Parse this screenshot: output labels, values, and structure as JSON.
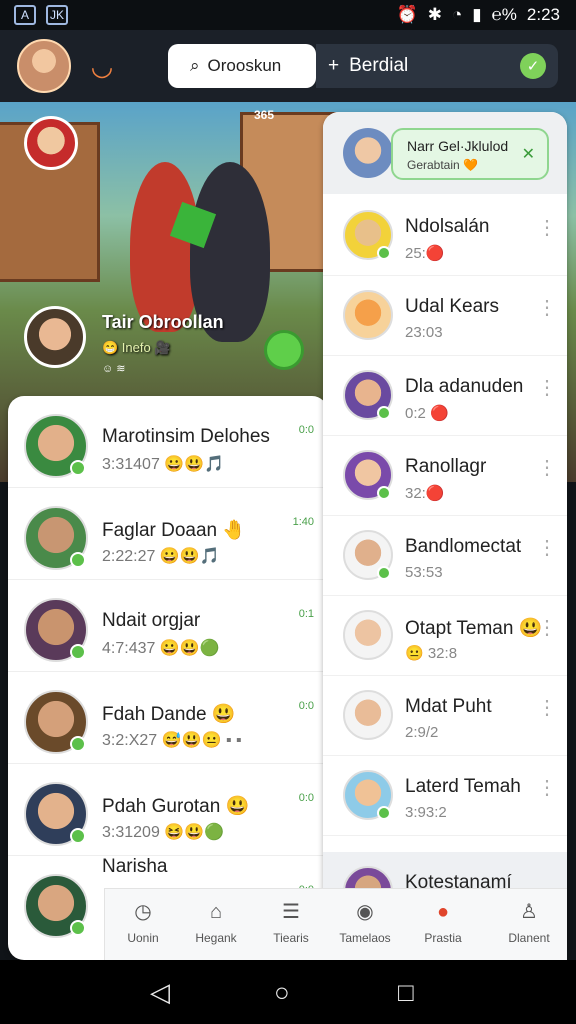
{
  "status": {
    "left_icons": [
      "image-icon",
      "app-icon"
    ],
    "left_labels": [
      "A",
      "JK"
    ],
    "battery": "℮%",
    "time": "2:23"
  },
  "header": {
    "search_placeholder": "Orooskun",
    "add_label": "+ ",
    "pill_text": "Berdial"
  },
  "banner": {
    "title": "Tair Obroollan",
    "subtitle": "😁 Inefo 🎥",
    "small": "☺ ≋",
    "top_badges": "365"
  },
  "left_list": [
    {
      "name": "Marotinsim Delohes",
      "meta": "3:31407 😀😃🎵",
      "time": "0:0"
    },
    {
      "name": "Faglar Doaan 🤚",
      "meta": "2:22:27 😀😃🎵",
      "time": "1:40"
    },
    {
      "name": "Ndait orgjar",
      "meta": "4:7:437 😀😃🟢",
      "time": "0:1"
    },
    {
      "name": "Fdah Dande 😃",
      "meta": "3:2:X27 😅😃😐 ▪ ▪",
      "time": "0:0"
    },
    {
      "name": "Pdah Gurotan 😃",
      "meta": "3:31209 😆😃🟢",
      "time": "0:0"
    },
    {
      "name": "Narisha",
      "meta": "",
      "time": "0:0"
    }
  ],
  "right_header": {
    "line1": "Narr Gel·Jklulod",
    "line2": "Gerabtain 🧡"
  },
  "right_list": [
    {
      "name": "Ndolsalán",
      "meta": "25:🔴"
    },
    {
      "name": "Udal Kears",
      "meta": "23:03"
    },
    {
      "name": "Dla adanuden",
      "meta": "0:2 🔴"
    },
    {
      "name": "Ranollagr",
      "meta": "32:🔴"
    },
    {
      "name": "Bandlomectat",
      "meta": "53:53"
    },
    {
      "name": "Otapt Teman 😃",
      "meta": "😐 32:8"
    },
    {
      "name": "Mdat Puht",
      "meta": "2:9/2"
    },
    {
      "name": "Laterd Temah",
      "meta": "3:93:2"
    },
    {
      "name": "Kotestanamí",
      "meta": ""
    }
  ],
  "tabs": [
    {
      "label": "Uonin",
      "icon": "clock-icon"
    },
    {
      "label": "Hegank",
      "icon": "store-icon"
    },
    {
      "label": "Tiearis",
      "icon": "list-icon"
    },
    {
      "label": "Tamelaos",
      "icon": "camera-icon"
    },
    {
      "label": "Prastia",
      "icon": "chat-icon"
    },
    {
      "label": "Dlanent",
      "icon": "person-icon"
    }
  ],
  "colors": {
    "accent_green": "#5cc04a",
    "dark_bar": "#1b2028"
  }
}
